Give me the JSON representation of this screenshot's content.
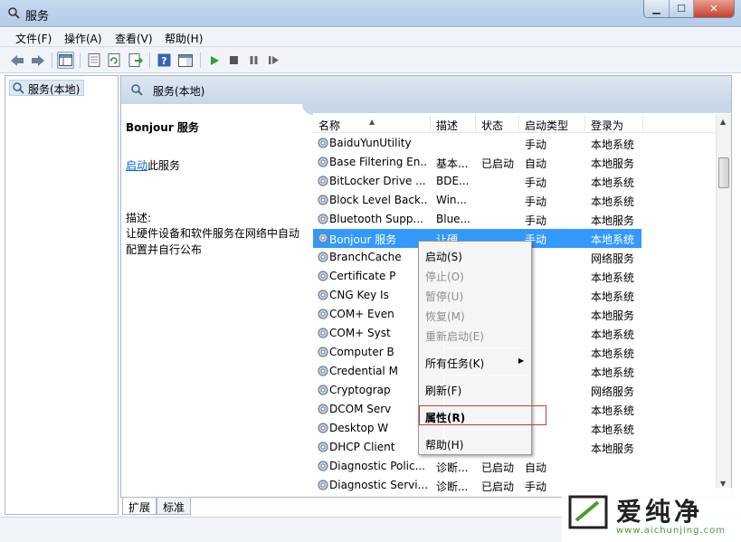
{
  "window": {
    "title": "服务",
    "min": "▁",
    "max": "☐",
    "close": "✕"
  },
  "menu": [
    "文件(F)",
    "操作(A)",
    "查看(V)",
    "帮助(H)"
  ],
  "tree": {
    "item": "服务(本地)"
  },
  "header": {
    "title": "服务(本地)"
  },
  "description_pane": {
    "service_name": "Bonjour 服务",
    "action_link": "启动",
    "action_suffix": "此服务",
    "desc_label": "描述:",
    "desc_text": "让硬件设备和软件服务在网络中自动配置并自行公布"
  },
  "columns": [
    "名称",
    "描述",
    "状态",
    "启动类型",
    "登录为"
  ],
  "rows": [
    {
      "name": "BaiduYunUtility",
      "desc": "",
      "status": "",
      "startup": "手动",
      "logon": "本地系统"
    },
    {
      "name": "Base Filtering En...",
      "desc": "基本...",
      "status": "已启动",
      "startup": "自动",
      "logon": "本地服务"
    },
    {
      "name": "BitLocker Drive ...",
      "desc": "BDE...",
      "status": "",
      "startup": "手动",
      "logon": "本地系统"
    },
    {
      "name": "Block Level Back...",
      "desc": "Win...",
      "status": "",
      "startup": "手动",
      "logon": "本地系统"
    },
    {
      "name": "Bluetooth Supp...",
      "desc": "Blue...",
      "status": "",
      "startup": "手动",
      "logon": "本地服务"
    },
    {
      "name": "Bonjour 服务",
      "desc": "让硬...",
      "status": "",
      "startup": "手动",
      "logon": "本地系统"
    },
    {
      "name": "BranchCache",
      "desc": "",
      "status": "",
      "startup": "",
      "logon": "网络服务"
    },
    {
      "name": "Certificate P",
      "desc": "",
      "status": "",
      "startup": "",
      "logon": "本地系统"
    },
    {
      "name": "CNG Key Is",
      "desc": "",
      "status": "",
      "startup": "",
      "logon": "本地系统"
    },
    {
      "name": "COM+ Even",
      "desc": "",
      "status": "",
      "startup": "",
      "logon": "本地服务"
    },
    {
      "name": "COM+ Syst",
      "desc": "",
      "status": "",
      "startup": "",
      "logon": "本地系统"
    },
    {
      "name": "Computer B",
      "desc": "",
      "status": "",
      "startup": "",
      "logon": "本地系统"
    },
    {
      "name": "Credential M",
      "desc": "",
      "status": "",
      "startup": "",
      "logon": "本地系统"
    },
    {
      "name": "Cryptograp",
      "desc": "",
      "status": "",
      "startup": "",
      "logon": "网络服务"
    },
    {
      "name": "DCOM Serv",
      "desc": "",
      "status": "",
      "startup": "",
      "logon": "本地系统"
    },
    {
      "name": "Desktop W",
      "desc": "",
      "status": "",
      "startup": "",
      "logon": "本地系统"
    },
    {
      "name": "DHCP Client",
      "desc": "",
      "status": "",
      "startup": "",
      "logon": "本地服务"
    },
    {
      "name": "Diagnostic Polic...",
      "desc": "诊断...",
      "status": "已启动",
      "startup": "自动",
      "logon": ""
    },
    {
      "name": "Diagnostic Servi...",
      "desc": "诊断...",
      "status": "已启动",
      "startup": "手动",
      "logon": ""
    }
  ],
  "context_menu": {
    "start": "启动(S)",
    "stop": "停止(O)",
    "pause": "暂停(U)",
    "resume": "恢复(M)",
    "restart": "重新启动(E)",
    "all_tasks": "所有任务(K)",
    "refresh": "刷新(F)",
    "properties": "属性(R)",
    "help": "帮助(H)"
  },
  "tabs": [
    "扩展",
    "标准"
  ],
  "watermark": {
    "brand": "爱纯净",
    "url": "www.aichunjing.com"
  },
  "colors": {
    "selection": "#3399ff",
    "link": "#0066cc",
    "highlight_box": "#c73b3b"
  }
}
